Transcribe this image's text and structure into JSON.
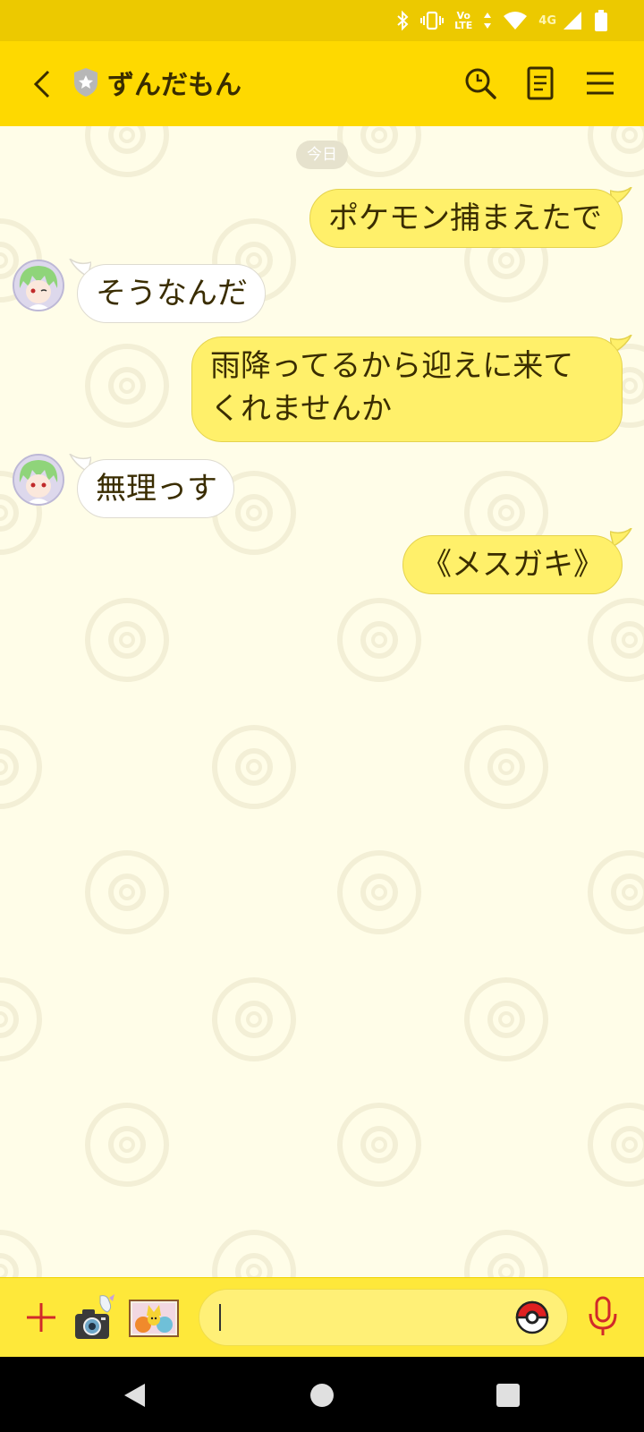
{
  "status_bar": {
    "icons": [
      "bluetooth-icon",
      "vibrate-icon",
      "volte-icon",
      "data-arrows-icon",
      "wifi-icon",
      "signal-icon",
      "battery-icon"
    ],
    "volte_top": "Vo",
    "volte_bottom": "LTE",
    "network": "4G"
  },
  "header": {
    "title": "ずんだもん",
    "background": "#fed900",
    "buttons": [
      "back-icon",
      "search-icon",
      "notes-icon",
      "menu-icon"
    ]
  },
  "chat": {
    "date_label": "今日",
    "messages": [
      {
        "from": "me",
        "lines": [
          "ポケモン捕まえたで"
        ]
      },
      {
        "from": "them",
        "lines": [
          "そうなんだ"
        ]
      },
      {
        "from": "me",
        "lines": [
          "雨降ってるから迎えに来て",
          "くれませんか"
        ]
      },
      {
        "from": "them",
        "lines": [
          "無理っす"
        ]
      },
      {
        "from": "me",
        "lines": [
          "《メスガキ》"
        ]
      }
    ]
  },
  "input_bar": {
    "value": "",
    "placeholder": "",
    "icons": [
      "plus-icon",
      "camera-icon",
      "sticker-icon",
      "pokeball-icon",
      "mic-icon"
    ]
  },
  "colors": {
    "my_bubble": "#fff06a",
    "their_bubble": "#ffffff",
    "status_bar": "#ecc900",
    "chat_background": "#fffde8"
  }
}
